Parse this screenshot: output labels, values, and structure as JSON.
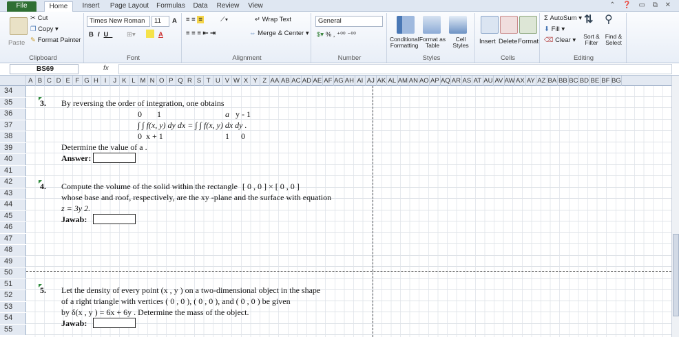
{
  "tabs": [
    "File",
    "Home",
    "Insert",
    "Page Layout",
    "Formulas",
    "Data",
    "Review",
    "View"
  ],
  "ribbon": {
    "clipboard": {
      "paste": "Paste",
      "cut": "Cut",
      "copy": "Copy",
      "format_painter": "Format Painter",
      "label": "Clipboard"
    },
    "font": {
      "name": "Times New Roman",
      "size": "11",
      "label": "Font"
    },
    "alignment": {
      "wrap": "Wrap Text",
      "merge": "Merge & Center",
      "label": "Alignment"
    },
    "number": {
      "format": "General",
      "label": "Number"
    },
    "styles": {
      "cond": "Conditional Formatting",
      "table": "Format as Table",
      "cell": "Cell Styles",
      "label": "Styles"
    },
    "cells": {
      "insert": "Insert",
      "delete": "Delete",
      "format": "Format",
      "label": "Cells"
    },
    "editing": {
      "autosum": "AutoSum",
      "fill": "Fill",
      "clear": "Clear",
      "sort": "Sort & Filter",
      "find": "Find & Select",
      "label": "Editing"
    }
  },
  "namebox": "BS69",
  "fx": "fx",
  "columns": [
    "A",
    "B",
    "C",
    "D",
    "E",
    "F",
    "G",
    "H",
    "I",
    "J",
    "K",
    "L",
    "M",
    "N",
    "O",
    "P",
    "Q",
    "R",
    "S",
    "T",
    "U",
    "V",
    "W",
    "X",
    "Y",
    "Z",
    "AA",
    "AB",
    "AC",
    "AD",
    "AE",
    "AF",
    "AG",
    "AH",
    "AI",
    "AJ",
    "AK",
    "AL",
    "AM",
    "AN",
    "AO",
    "AP",
    "AQ",
    "AR",
    "AS",
    "AT",
    "AU",
    "AV",
    "AW",
    "AX",
    "AY",
    "AZ",
    "BA",
    "BB",
    "BC",
    "BD",
    "BE",
    "BF",
    "BG"
  ],
  "rows": [
    "34",
    "35",
    "36",
    "37",
    "38",
    "39",
    "40",
    "41",
    "42",
    "43",
    "44",
    "45",
    "46",
    "47",
    "48",
    "49",
    "50",
    "51",
    "52",
    "53",
    "54",
    "55"
  ],
  "q3": {
    "num": "3.",
    "text": "By reversing the order of integration, one obtains",
    "r36a": "0",
    "r36b": "1",
    "r36c": "a",
    "r36d": "y - 1",
    "r37": "∫   ∫   f(x, y) dy dx  =  ∫   ∫   f(x, y) dx dy .",
    "r38a": "0",
    "r38b": "x + 1",
    "r38c": "1",
    "r38d": "0",
    "ask": "Determine the value of a .",
    "ans": "Answer:"
  },
  "q4": {
    "num": "4.",
    "line1": "Compute the volume of the solid within the rectangle",
    "rect": "[ 0 ,   0 ]  ×  [ 0 ,   0 ]",
    "line2": "whose base and roof, respectively, are the xy -plane and the surface with equation",
    "line3": "z = 3y 2.",
    "ans": "Jawab:"
  },
  "q5": {
    "num": "5.",
    "line1": "Let the density of every point (x , y ) on a two-dimensional object in the shape",
    "line2": "of a right triangle with vertices (     0 ,   0 ),    ( 0 ,   0 ),   and (  0 ,    0  ) be given",
    "line3": "by δ(x , y ) = 6x + 6y . Determine the mass of the object.",
    "ans": "Jawab:"
  }
}
